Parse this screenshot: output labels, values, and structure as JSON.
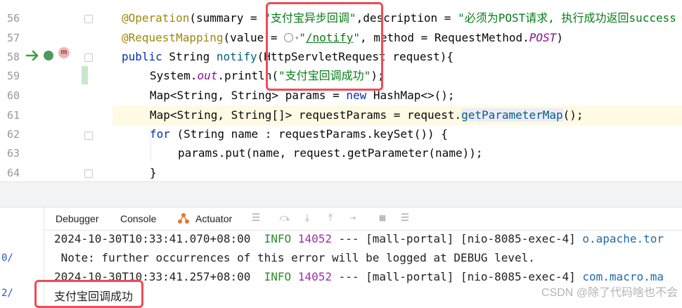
{
  "editor": {
    "line_numbers": [
      "56",
      "57",
      "58",
      "59",
      "60",
      "61",
      "62",
      "63",
      "64"
    ],
    "lines": {
      "l56": {
        "annotation": "@Operation",
        "p1": "(summary = ",
        "summary_value": "\"支付宝异步回调\"",
        "p2": ",description = ",
        "desc_value": "\"必须为POST请求, 执行成功返回success"
      },
      "l57": {
        "annotation": "@RequestMapping",
        "p1": "(value = ",
        "icon": "globe-icon",
        "value_q1": "\"",
        "value_link": "/notify",
        "value_q2": "\"",
        "p2": ", method = RequestMethod.",
        "post": "POST",
        "p3": ")"
      },
      "l58": {
        "kw": "public",
        "type": " String ",
        "method": "notify",
        "rest": "(HttpServletRequest request){"
      },
      "l59": {
        "obj": "System.",
        "field": "out",
        "call": ".println(",
        "str": "\"支付宝回调成功\"",
        "end": ");"
      },
      "l60": {
        "decl": "Map<String, String> params = ",
        "kw": "new",
        "rest": " HashMap<>();"
      },
      "l61": {
        "decl": "Map<String, String[]> requestParams = request.",
        "method": "getParameterMap",
        "end": "();"
      },
      "l62": {
        "kw": "for",
        "rest": " (String name : requestParams.keySet()) {"
      },
      "l63": {
        "text": "params.put(name, request.getParameter(name));"
      },
      "l64": {
        "text": "}"
      }
    }
  },
  "tool_window": {
    "tabs": {
      "debugger": "Debugger",
      "console": "Console",
      "actuator": "Actuator"
    },
    "left_fragments": [
      "0/",
      "2/"
    ],
    "console": {
      "line1": {
        "ts": "2024-10-30T10:33:41.070+08:00",
        "level": "INFO",
        "pid": "14052",
        "rest": " --- [mall-portal] [nio-8085-exec-4] ",
        "cls": "o.apache.tor"
      },
      "line2": " Note: further occurrences of this error will be logged at DEBUG level.",
      "line3": {
        "ts": "2024-10-30T10:33:41.257+08:00",
        "level": "INFO",
        "pid": "14052",
        "rest": " --- [mall-portal] [nio-8085-exec-4] ",
        "cls": "com.macro.ma"
      },
      "line4": "支付宝回调成功"
    }
  },
  "watermark": "CSDN @除了代码啥也不会",
  "colors": {
    "highlight_box": "#ef4b55",
    "annotation": "#9e880d",
    "keyword": "#0033b3",
    "string": "#067d17"
  }
}
